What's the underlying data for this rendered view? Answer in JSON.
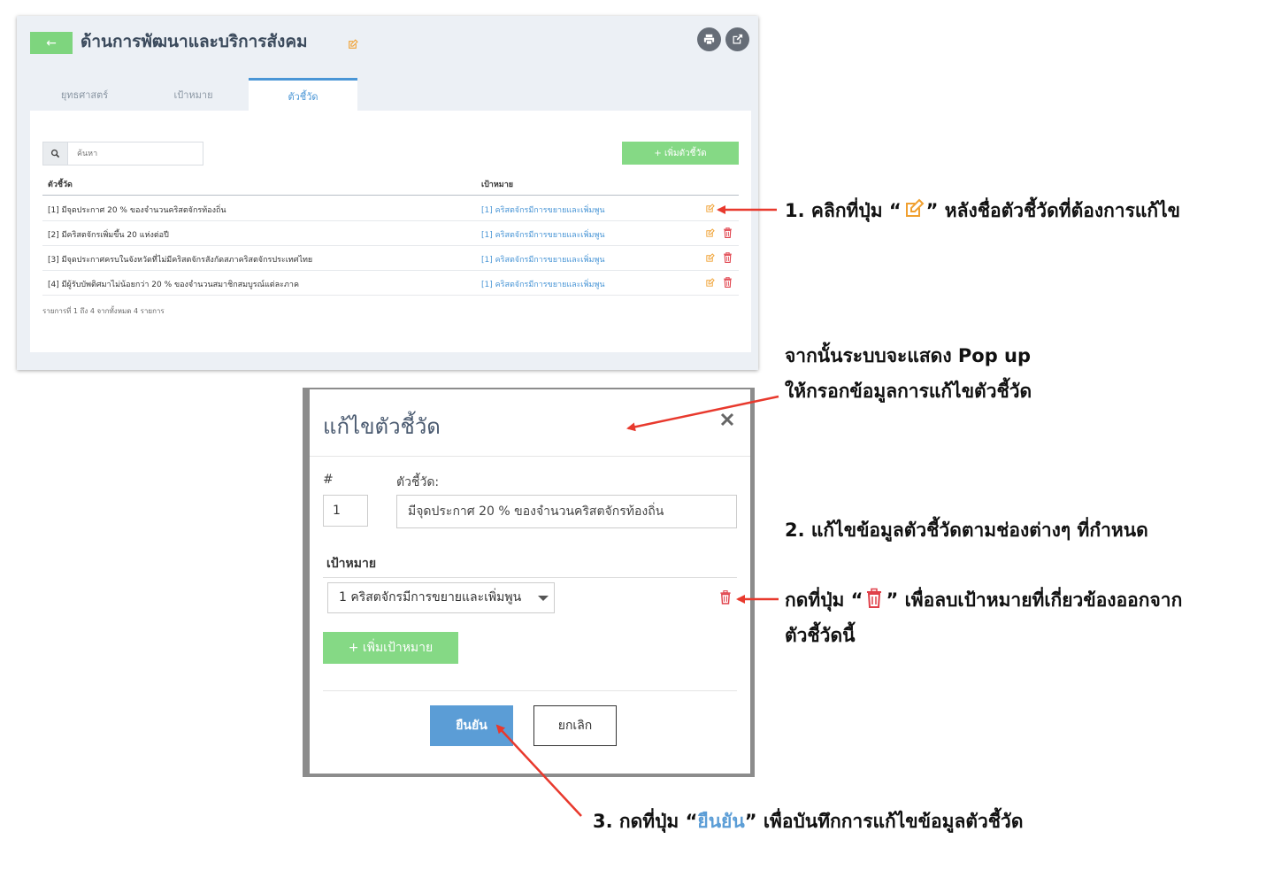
{
  "page": {
    "title": "ด้านการพัฒนาและบริการสังคม",
    "back_label": "←",
    "tabs": [
      {
        "label": "ยุทธศาสตร์"
      },
      {
        "label": "เป้าหมาย"
      },
      {
        "label": "ตัวชี้วัด",
        "active": true
      }
    ],
    "search_placeholder": "ค้นหา",
    "add_indicator_label": "+ เพิ่มตัวชี้วัด",
    "columns": [
      "ตัวชี้วัด",
      "เป้าหมาย"
    ],
    "rows": [
      {
        "indicator": "[1] มีจุดประกาศ 20 % ของจำนวนคริสตจักรท้องถิ่น",
        "target": "[1] คริสตจักรมีการขยายและเพิ่มพูน"
      },
      {
        "indicator": "[2] มีคริสตจักรเพิ่มขึ้น 20 แห่งต่อปี",
        "target": "[1] คริสตจักรมีการขยายและเพิ่มพูน"
      },
      {
        "indicator": "[3] มีจุดประกาศครบในจังหวัดที่ไม่มีคริสตจักรสังกัดสภาคริสตจักรประเทศไทย",
        "target": "[1] คริสตจักรมีการขยายและเพิ่มพูน"
      },
      {
        "indicator": "[4] มีผู้รับบัพติศมาไม่น้อยกว่า 20 % ของจำนวนสมาชิกสมบูรณ์แต่ละภาค",
        "target": "[1] คริสตจักรมีการขยายและเพิ่มพูน"
      }
    ],
    "footer": "รายการที่ 1 ถึง 4 จากทั้งหมด 4 รายการ"
  },
  "modal": {
    "title": "แก้ไขตัวชี้วัด",
    "number_label": "#",
    "number_value": "1",
    "indicator_label": "ตัวชี้วัด:",
    "indicator_value": "มีจุดประกาศ 20 % ของจำนวนคริสตจักรท้องถิ่น",
    "target_header": "เป้าหมาย",
    "target_selected": "1 คริสตจักรมีการขยายและเพิ่มพูน",
    "add_target_label": "+ เพิ่มเป้าหมาย",
    "confirm_label": "ยืนยัน",
    "cancel_label": "ยกเลิก"
  },
  "annotations": {
    "step1_pre": "1. คลิกที่ปุ่ม “",
    "step1_post": "” หลังชื่อตัวชี้วัดที่ต้องการแก้ไข",
    "popup_line1": "จากนั้นระบบจะแสดง Pop up",
    "popup_line2": "ให้กรอกข้อมูลการแก้ไขตัวชี้วัด",
    "step2": "2. แก้ไขข้อมูลตัวชี้วัดตามช่องต่างๆ ที่กำหนด",
    "delete_pre": "กดที่ปุ่ม “",
    "delete_post": "” เพื่อลบเป้าหมายที่เกี่ยวข้องออกจาก",
    "delete_line2": "ตัวชี้วัดนี้",
    "step3_pre": "3. กดที่ปุ่ม “",
    "step3_word": "ยืนยัน",
    "step3_post": "” เพื่อบันทึกการแก้ไขข้อมูลตัวชี้วัด"
  },
  "colors": {
    "green": "#85d985",
    "blue": "#5b9dd6",
    "edit_orange": "#f0a030",
    "trash_red": "#e0404a",
    "arrow_red": "#e8392d"
  }
}
